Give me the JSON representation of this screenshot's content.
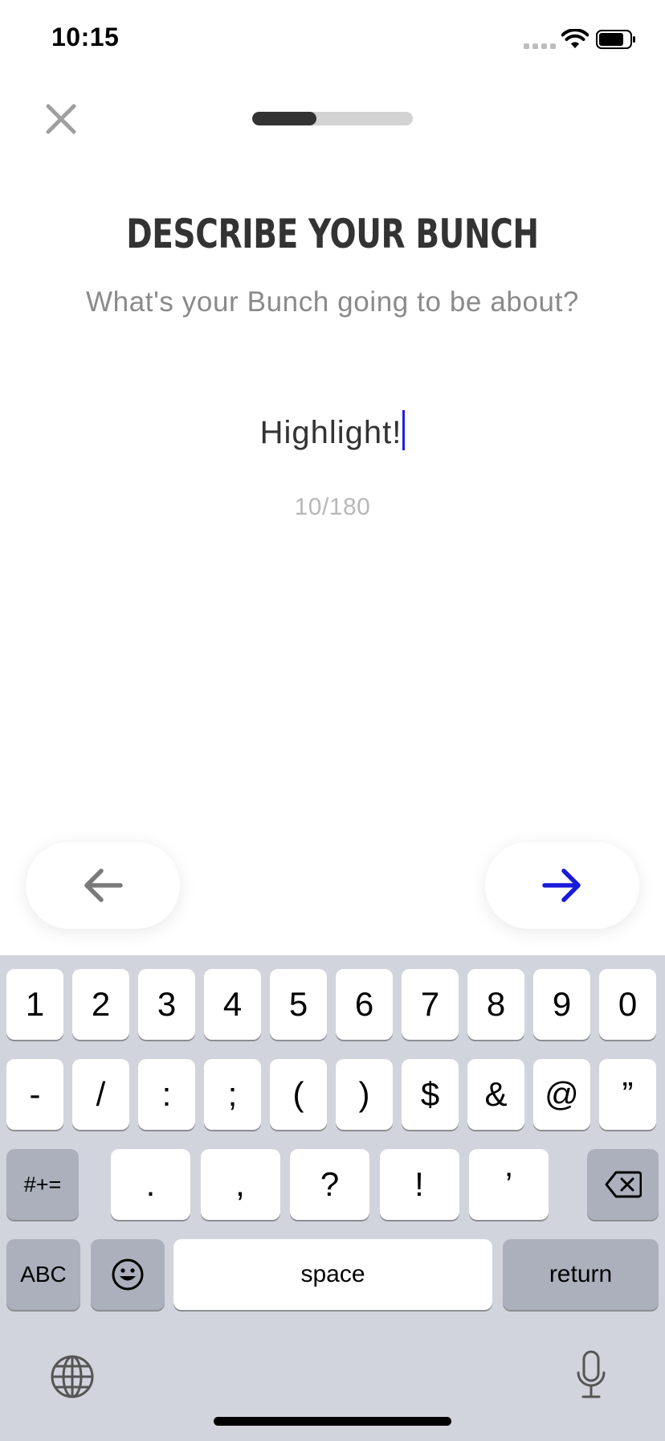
{
  "status_bar": {
    "time": "10:15"
  },
  "header": {
    "progress_fraction": 0.4
  },
  "content": {
    "title": "DESCRIBE YOUR BUNCH",
    "subtitle": "What's your Bunch going to be about?",
    "description_value": "Highlight!",
    "char_count": "10/180"
  },
  "keyboard": {
    "row1": [
      "1",
      "2",
      "3",
      "4",
      "5",
      "6",
      "7",
      "8",
      "9",
      "0"
    ],
    "row2": [
      "-",
      "/",
      ":",
      ";",
      "(",
      ")",
      "$",
      "&",
      "@",
      "”"
    ],
    "row3": [
      ".",
      ",",
      "?",
      "!",
      "’"
    ],
    "symbols_label": "#+=",
    "abc_label": "ABC",
    "space_label": "space",
    "return_label": "return"
  },
  "colors": {
    "accent": "#1a1adb",
    "title_text": "#333333",
    "subtitle_text": "#8a8a8a",
    "counter_text": "#b8b8b8",
    "progress_track": "#d3d3d3",
    "progress_fill": "#333333",
    "keyboard_bg": "#d1d4dc",
    "key_dark": "#abb0bc"
  },
  "icons": {
    "close": "close-icon",
    "back": "arrow-left-icon",
    "next": "arrow-right-icon",
    "delete": "backspace-icon",
    "emoji": "emoji-icon",
    "globe": "globe-icon",
    "mic": "microphone-icon"
  }
}
